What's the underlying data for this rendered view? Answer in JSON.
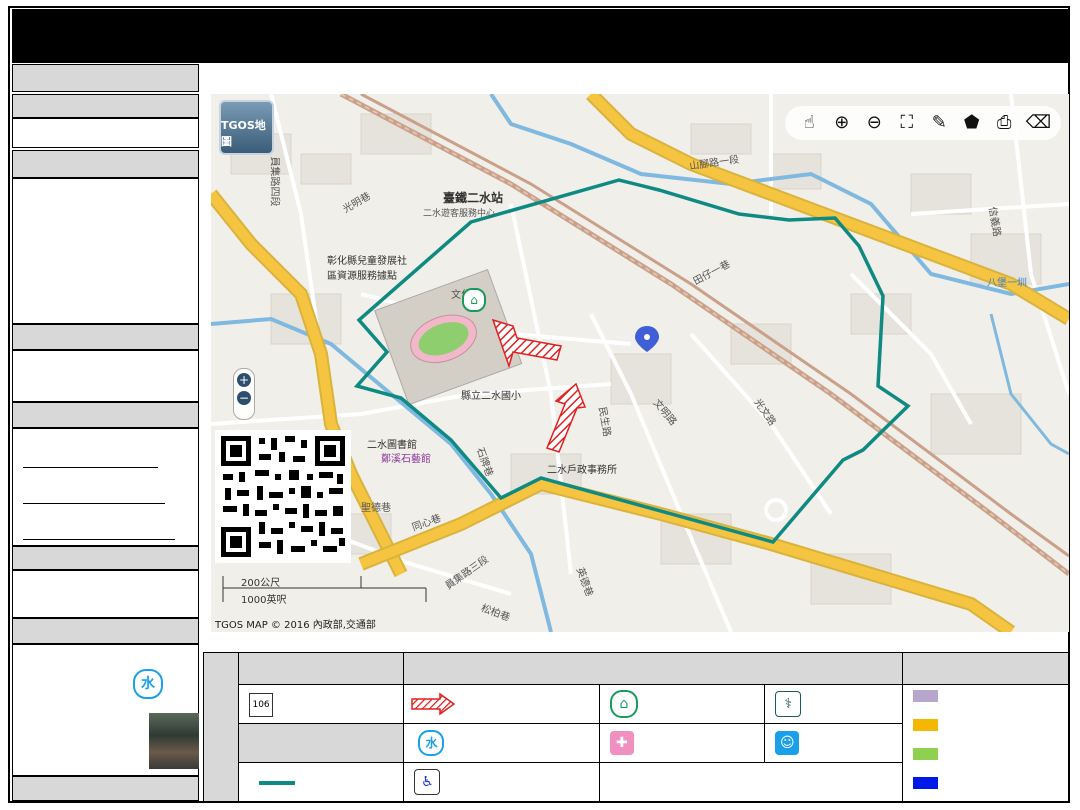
{
  "map": {
    "tgos_logo": "TGOS地圖",
    "station": "臺鐵二水站",
    "labels": {
      "station_sub": "二水遊客服務中心",
      "rd_shanjiao": "山腳路一段",
      "rd_yuanji": "員集路三段",
      "rd_yuanji2": "員集路四段",
      "rd_guangming": "光明巷",
      "rd_wenhua": "文化巷",
      "rd_tianzi": "田仔一巷",
      "rd_wenming": "文明路",
      "rd_minsheng": "民生路",
      "rd_guangwen": "光文路",
      "rd_baguai": "八堡一圳",
      "rd_shipang": "石牌巷",
      "rd_shengge": "聖德巷",
      "rd_tongxin": "同心巷",
      "rd_yingge": "英德巷",
      "rd_song": "松柏巷",
      "rd_xinyi": "信義路",
      "school": "縣立二水國小",
      "household": "二水戶政事務所",
      "library": "二水圖書館",
      "stone": "鄭溪石藝館",
      "children": "彰化縣兒童發展社區資源服務據點"
    },
    "scale": {
      "metric": "200公尺",
      "imperial": "1000英呎"
    },
    "copyright": "TGOS MAP © 2016 內政部,交通部"
  },
  "legend": {
    "route_badge": "106",
    "water_symbol": "水"
  },
  "sidebar": {
    "water_symbol": "水"
  },
  "colors": {
    "boundary": "#0f8a82",
    "main_road": "#f5c542",
    "arrow": "#e02020",
    "swatch_purple": "#b8a7cc",
    "swatch_orange": "#f5b800",
    "swatch_green": "#8fd14f",
    "swatch_blue": "#0018e8"
  }
}
